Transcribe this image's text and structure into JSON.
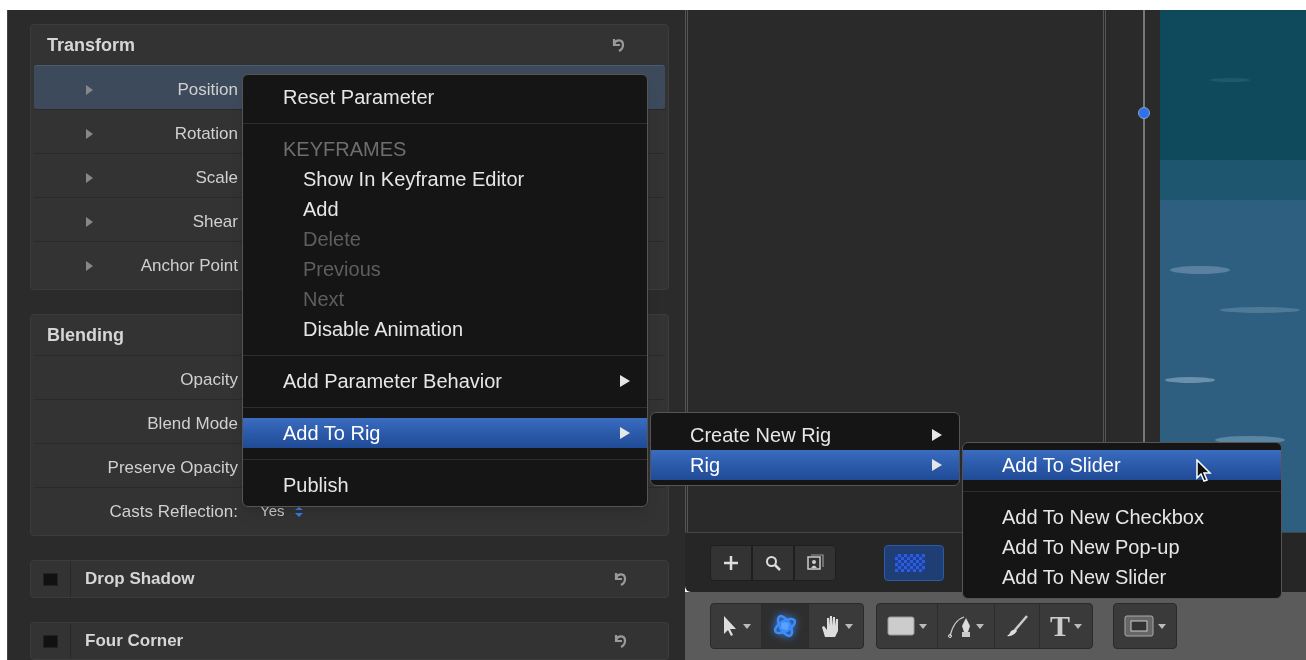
{
  "inspector": {
    "groups": [
      {
        "title": "Transform",
        "kind": "expanded",
        "reset_button": true,
        "rows": [
          {
            "label": "Position",
            "expanded": false,
            "selected": true
          },
          {
            "label": "Rotation",
            "expanded": false,
            "selected": false
          },
          {
            "label": "Scale",
            "expanded": false,
            "selected": false
          },
          {
            "label": "Shear",
            "expanded": false,
            "selected": false
          },
          {
            "label": "Anchor Point",
            "expanded": false,
            "selected": false
          }
        ]
      },
      {
        "title": "Blending",
        "kind": "expanded",
        "rows": [
          {
            "label": "Opacity",
            "selected": false
          },
          {
            "label": "Blend Mode",
            "selected": false
          },
          {
            "label": "Preserve Opacity",
            "selected": false
          },
          {
            "label": "Casts Reflection:",
            "value": "Yes",
            "selected": false
          }
        ]
      },
      {
        "title": "Drop Shadow",
        "kind": "collapsed",
        "enabled": false,
        "reset_button": true
      },
      {
        "title": "Four Corner",
        "kind": "collapsed",
        "enabled": false,
        "reset_button": true
      }
    ]
  },
  "context_menu": {
    "items": [
      {
        "kind": "item",
        "label": "Reset Parameter",
        "disabled": false,
        "selected": false
      },
      {
        "kind": "separator"
      },
      {
        "kind": "header",
        "label": "KEYFRAMES",
        "children": [
          {
            "kind": "item",
            "label": "Show In Keyframe Editor",
            "disabled": false,
            "selected": false
          },
          {
            "kind": "item",
            "label": "Add",
            "disabled": false,
            "selected": false
          },
          {
            "kind": "item",
            "label": "Delete",
            "disabled": true,
            "selected": false
          },
          {
            "kind": "item",
            "label": "Previous",
            "disabled": true,
            "selected": false
          },
          {
            "kind": "item",
            "label": "Next",
            "disabled": true,
            "selected": false
          },
          {
            "kind": "item",
            "label": "Disable Animation",
            "disabled": false,
            "selected": false
          }
        ]
      },
      {
        "kind": "separator"
      },
      {
        "kind": "submenu",
        "label": "Add Parameter Behavior",
        "disabled": false,
        "selected": false
      },
      {
        "kind": "separator"
      },
      {
        "kind": "submenu",
        "label": "Add To Rig",
        "disabled": false,
        "selected": true
      },
      {
        "kind": "separator"
      },
      {
        "kind": "item",
        "label": "Publish",
        "disabled": false,
        "selected": false
      }
    ]
  },
  "rig_submenu": {
    "items": [
      {
        "kind": "submenu",
        "label": "Create New Rig",
        "disabled": false,
        "selected": false
      },
      {
        "kind": "submenu",
        "label": "Rig",
        "disabled": false,
        "selected": true
      }
    ]
  },
  "rig_target_submenu": {
    "items": [
      {
        "kind": "item",
        "label": "Add To Slider",
        "disabled": false,
        "selected": true
      },
      {
        "kind": "separator"
      },
      {
        "kind": "item",
        "label": "Add To New Checkbox",
        "disabled": false,
        "selected": false
      },
      {
        "kind": "item",
        "label": "Add To New Pop-up",
        "disabled": false,
        "selected": false
      },
      {
        "kind": "item",
        "label": "Add To New Slider",
        "disabled": false,
        "selected": false
      }
    ]
  },
  "layers_buttons": [
    {
      "kind": "add"
    },
    {
      "kind": "search"
    },
    {
      "kind": "frame"
    },
    {
      "kind": "checker",
      "selected": true
    }
  ],
  "tool_groups": [
    {
      "tools": [
        {
          "kind": "select",
          "selected": false,
          "dropdown": true
        },
        {
          "kind": "orbit",
          "selected": true,
          "dropdown": false
        },
        {
          "kind": "hand",
          "selected": false,
          "dropdown": true
        }
      ]
    },
    {
      "tools": [
        {
          "kind": "rectangle",
          "selected": false,
          "dropdown": true
        },
        {
          "kind": "pen",
          "selected": false,
          "dropdown": true
        },
        {
          "kind": "brush",
          "selected": false,
          "dropdown": false
        },
        {
          "kind": "text",
          "glyph": "T",
          "selected": false,
          "dropdown": true
        }
      ]
    },
    {
      "tools": [
        {
          "kind": "frame",
          "selected": false,
          "dropdown": true
        }
      ]
    }
  ]
}
